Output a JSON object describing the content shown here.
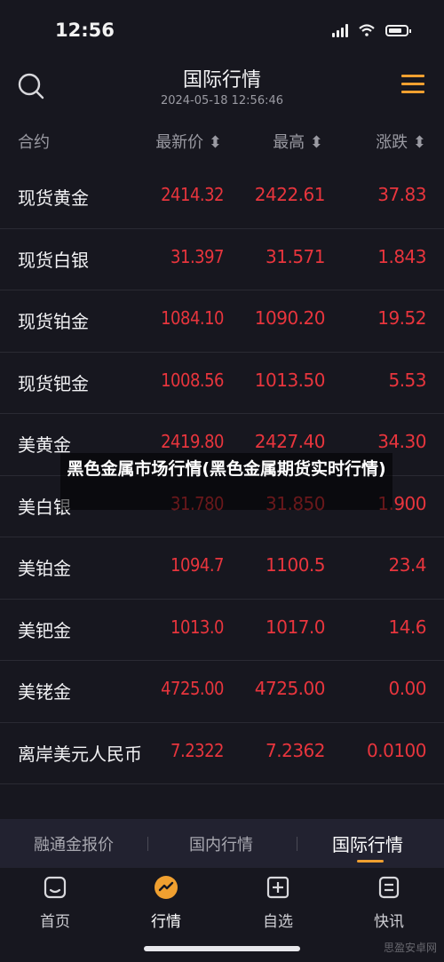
{
  "status": {
    "time": "12:56"
  },
  "header": {
    "title": "国际行情",
    "subtitle": "2024-05-18 12:56:46"
  },
  "columns": {
    "name": "合约",
    "latest": "最新价 ⬍",
    "high": "最高 ⬍",
    "change": "涨跌 ⬍"
  },
  "rows": [
    {
      "name": "现货黄金",
      "latest": "2414.32",
      "high": "2422.61",
      "change": "37.83"
    },
    {
      "name": "现货白银",
      "latest": "31.397",
      "high": "31.571",
      "change": "1.843"
    },
    {
      "name": "现货铂金",
      "latest": "1084.10",
      "high": "1090.20",
      "change": "19.52"
    },
    {
      "name": "现货钯金",
      "latest": "1008.56",
      "high": "1013.50",
      "change": "5.53"
    },
    {
      "name": "美黄金",
      "latest": "2419.80",
      "high": "2427.40",
      "change": "34.30"
    },
    {
      "name": "美白银",
      "latest": "31.780",
      "high": "31.850",
      "change": "1.900"
    },
    {
      "name": "美铂金",
      "latest": "1094.7",
      "high": "1100.5",
      "change": "23.4"
    },
    {
      "name": "美钯金",
      "latest": "1013.0",
      "high": "1017.0",
      "change": "14.6"
    },
    {
      "name": "美铑金",
      "latest": "4725.00",
      "high": "4725.00",
      "change": "0.00"
    },
    {
      "name": "离岸美元人民币",
      "latest": "7.2322",
      "high": "7.2362",
      "change": "0.0100"
    }
  ],
  "overlay": {
    "caption": "黑色金属市场行情(黑色金属期货实时行情)"
  },
  "subtabs": [
    "融通金报价",
    "国内行情",
    "国际行情"
  ],
  "tabbar": [
    "首页",
    "行情",
    "自选",
    "快讯"
  ],
  "watermark": "思盈安卓网",
  "colors": {
    "accent": "#f0a030",
    "up": "#e8353d",
    "background": "#17171f"
  }
}
